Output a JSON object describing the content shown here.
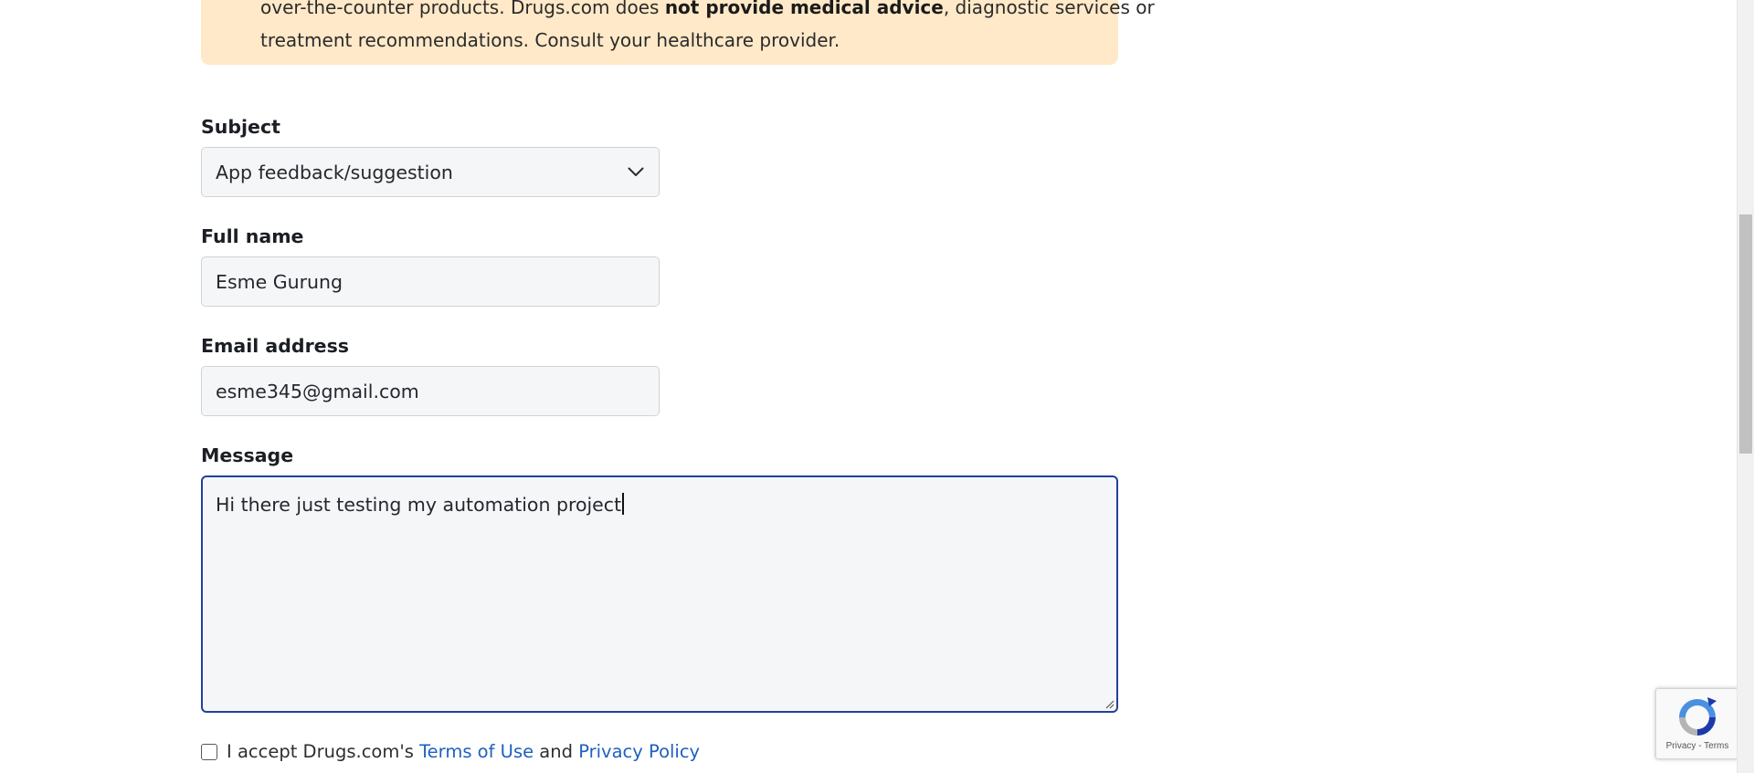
{
  "notice": {
    "line1_prefix": "over-the-counter products. Drugs.com does ",
    "line1_bold": "not provide medical advice",
    "line1_suffix": ", diagnostic services or",
    "line2": "treatment recommendations. Consult your healthcare provider."
  },
  "form": {
    "subject": {
      "label": "Subject",
      "selected": "App feedback/suggestion"
    },
    "full_name": {
      "label": "Full name",
      "value": "Esme Gurung"
    },
    "email": {
      "label": "Email address",
      "value": "esme345@gmail.com"
    },
    "message": {
      "label": "Message",
      "value": "Hi there just testing my automation project"
    },
    "consent": {
      "prefix": "I accept Drugs.com's ",
      "terms_link": "Terms of Use",
      "middle": " and ",
      "privacy_link": "Privacy Policy"
    }
  },
  "recaptcha": {
    "links": "Privacy - Terms"
  },
  "icons": {
    "subject_dropdown": "chevron-down-icon",
    "recaptcha": "recaptcha-logo-icon"
  },
  "colors": {
    "notice_bg": "#ffe9c8",
    "focus_border": "#23409a",
    "link": "#1f5fc0",
    "field_bg": "#f5f6f8"
  }
}
